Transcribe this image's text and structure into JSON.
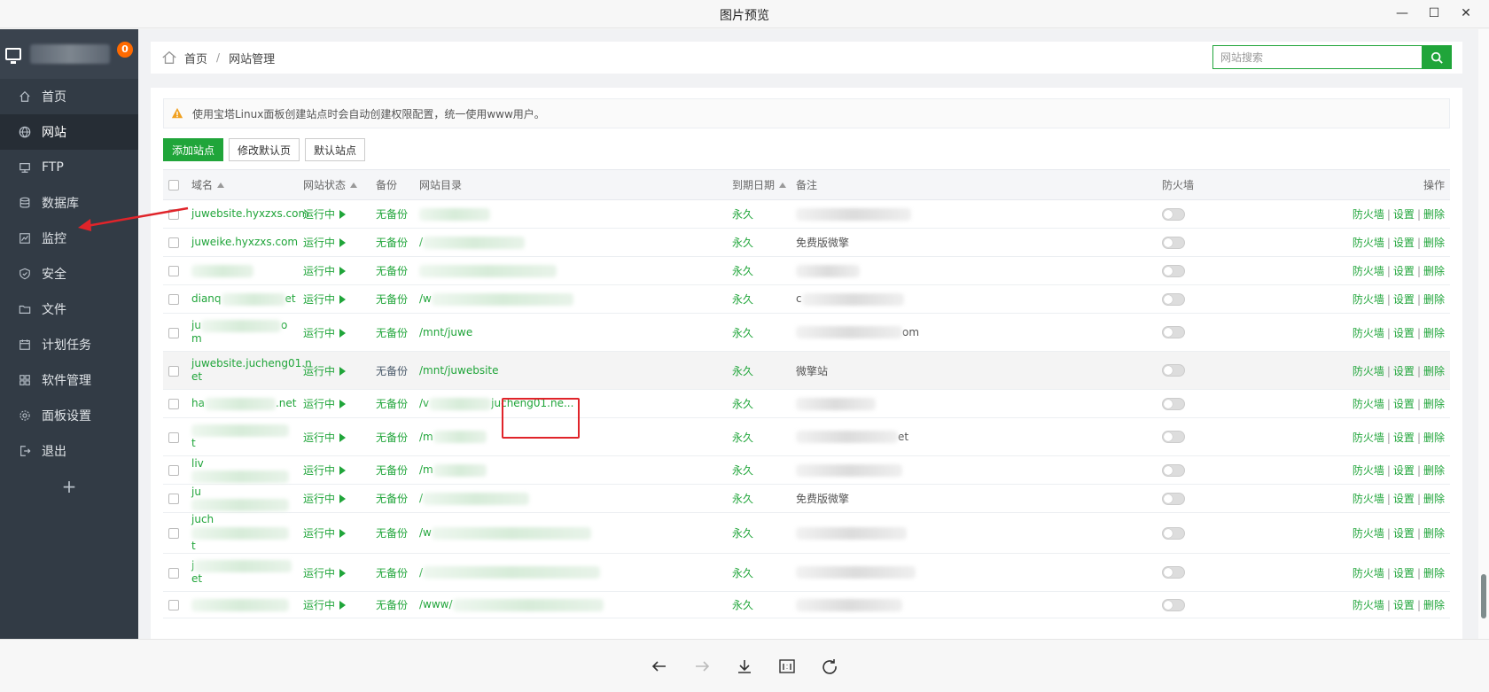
{
  "window": {
    "title": "图片预览",
    "minimize_icon": "minimize-icon",
    "maximize_icon": "maximize-icon",
    "close_icon": "close-icon"
  },
  "sidebar": {
    "badge": "0",
    "items": [
      {
        "label": "首页",
        "icon": "home-icon"
      },
      {
        "label": "网站",
        "icon": "globe-icon"
      },
      {
        "label": "FTP",
        "icon": "ftp-icon"
      },
      {
        "label": "数据库",
        "icon": "database-icon"
      },
      {
        "label": "监控",
        "icon": "monitor-icon"
      },
      {
        "label": "安全",
        "icon": "shield-icon"
      },
      {
        "label": "文件",
        "icon": "folder-icon"
      },
      {
        "label": "计划任务",
        "icon": "calendar-icon"
      },
      {
        "label": "软件管理",
        "icon": "apps-icon"
      },
      {
        "label": "面板设置",
        "icon": "gear-icon"
      },
      {
        "label": "退出",
        "icon": "logout-icon"
      }
    ],
    "add_label": "+"
  },
  "breadcrumb": {
    "home": "首页",
    "sep": "/",
    "current": "网站管理"
  },
  "search": {
    "placeholder": "网站搜索"
  },
  "notice": "使用宝塔Linux面板创建站点时会自动创建权限配置，统一使用www用户。",
  "toolbar": {
    "add": "添加站点",
    "modify_default": "修改默认页",
    "default_site": "默认站点"
  },
  "table": {
    "headers": {
      "domain": "域名",
      "status": "网站状态",
      "backup": "备份",
      "dir": "网站目录",
      "expire": "到期日期",
      "note": "备注",
      "firewall": "防火墙",
      "ops": "操作"
    },
    "ops": {
      "firewall": "防火墙",
      "settings": "设置",
      "delete": "删除",
      "sep": "|"
    },
    "rows": [
      {
        "domain": "juwebsite.hyxzxs.com",
        "status": "运行中",
        "backup": "无备份",
        "dir": "",
        "expire": "永久",
        "note": ""
      },
      {
        "domain": "juweike.hyxzxs.com",
        "status": "运行中",
        "backup": "无备份",
        "dir": "/",
        "expire": "永久",
        "note": "免费版微擎"
      },
      {
        "domain": "",
        "status": "运行中",
        "backup": "无备份",
        "dir": "",
        "expire": "永久",
        "note": ""
      },
      {
        "domain": "dianq",
        "domain_tail": "et",
        "status": "运行中",
        "backup": "无备份",
        "dir": "/w",
        "expire": "永久",
        "note": "c"
      },
      {
        "domain": "ju",
        "domain_tail": "o",
        "domain_line2": "m",
        "status": "运行中",
        "backup": "无备份",
        "dir": "/mnt/juwe",
        "expire": "永久",
        "note": "",
        "note_tail": "om"
      },
      {
        "domain": "juwebsite.jucheng01.n",
        "domain_line2": "et",
        "status": "运行中",
        "backup": "无备份",
        "dir": "/mnt/juwebsite",
        "expire": "永久",
        "note": "微擎站"
      },
      {
        "domain": "ha",
        "domain_tail": ".net",
        "status": "运行中",
        "backup": "无备份",
        "dir": "/v",
        "dir_tail": "jucheng01.ne...",
        "expire": "永久",
        "note": ""
      },
      {
        "domain": "",
        "domain_line2": "t",
        "status": "运行中",
        "backup": "无备份",
        "dir": "/m",
        "expire": "永久",
        "note": "",
        "note_tail": "et"
      },
      {
        "domain": "liv",
        "status": "运行中",
        "backup": "无备份",
        "dir": "/m",
        "expire": "永久",
        "note": ""
      },
      {
        "domain": "ju",
        "status": "运行中",
        "backup": "无备份",
        "dir": "/",
        "expire": "永久",
        "note": "免费版微擎"
      },
      {
        "domain": "juch",
        "domain_line2": "t",
        "status": "运行中",
        "backup": "无备份",
        "dir": "/w",
        "expire": "永久",
        "note": ""
      },
      {
        "domain": "j",
        "domain_line2": "et",
        "status": "运行中",
        "backup": "无备份",
        "dir": "/",
        "expire": "永久",
        "note": ""
      },
      {
        "domain": "",
        "status": "运行中",
        "backup": "无备份",
        "dir": "/www/",
        "expire": "永久",
        "note": ""
      }
    ]
  },
  "bottom_tools": [
    {
      "icon": "arrow-left-icon"
    },
    {
      "icon": "arrow-right-icon"
    },
    {
      "icon": "download-icon"
    },
    {
      "icon": "actual-size-icon"
    },
    {
      "icon": "rotate-icon"
    }
  ],
  "colors": {
    "accent": "#20a53a",
    "sidebar": "#323b45",
    "highlight": "#e0242a",
    "badge": "#ff6a00"
  }
}
